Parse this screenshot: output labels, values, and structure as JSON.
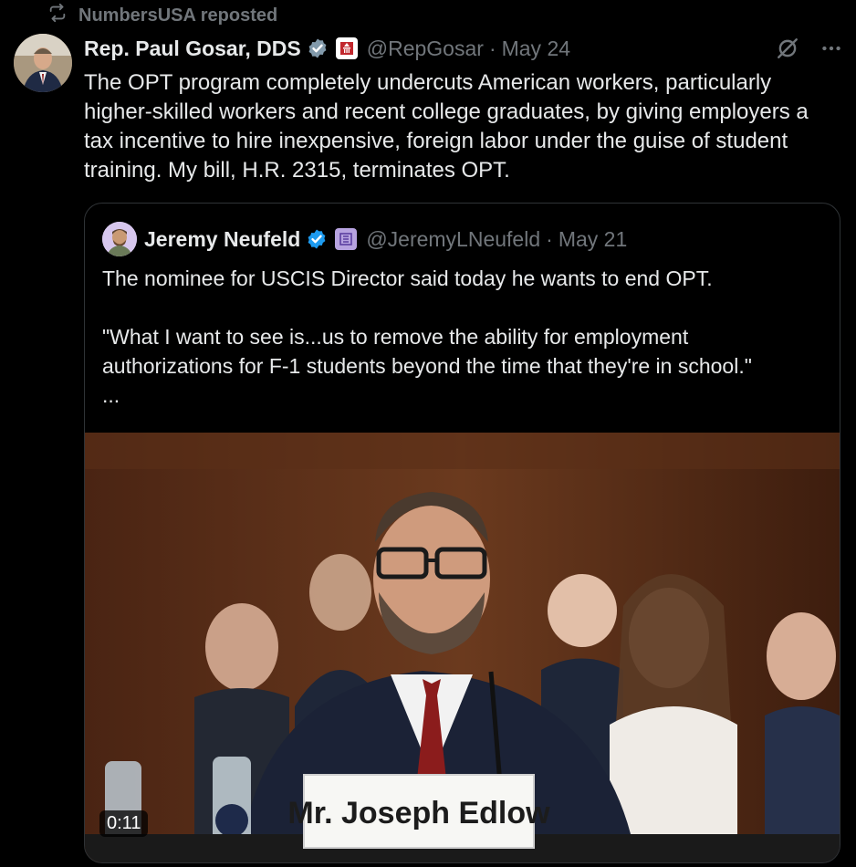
{
  "repost": {
    "text": "NumbersUSA reposted",
    "icon": "repost-icon"
  },
  "author": {
    "name": "Rep. Paul Gosar, DDS",
    "handle": "@RepGosar",
    "separator": "·",
    "date": "May 24",
    "verified_color": "#829aab"
  },
  "tweet": {
    "text": "The OPT program completely undercuts American workers, particularly higher-skilled workers and recent college graduates, by giving employers a tax incentive to hire inexpensive, foreign labor under the guise of student training. My bill, H.R. 2315, terminates OPT."
  },
  "quoted": {
    "name": "Jeremy Neufeld",
    "handle": "@JeremyLNeufeld",
    "separator": "·",
    "date": "May 21",
    "verified_color": "#1d9bf0",
    "line1": "The nominee for USCIS Director said today he wants to end OPT.",
    "line2": "\"What I want to see is...us to remove the ability for employment authorizations for F-1 students beyond the time that they're in school.\"",
    "more": "...",
    "video": {
      "duration": "0:11",
      "nameplate": "Mr. Joseph Edlow"
    }
  },
  "colors": {
    "background": "#000000",
    "muted": "#71767b",
    "text": "#e7e9ea",
    "border": "#2f3336"
  }
}
